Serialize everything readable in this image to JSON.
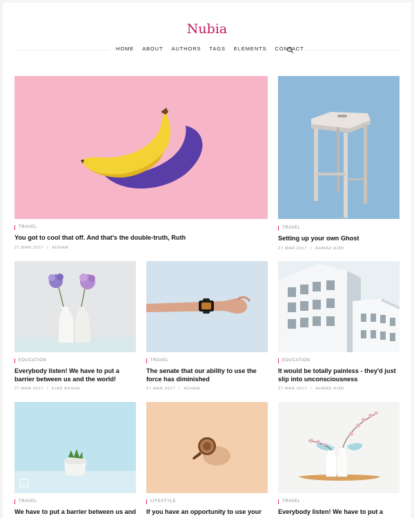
{
  "site": {
    "logo": "Nubia"
  },
  "nav": [
    "Home",
    "About",
    "Authors",
    "Tags",
    "Elements",
    "Contact"
  ],
  "posts": [
    {
      "tag": "Travel",
      "title": "You got to cool that off. And that's the double-truth, Ruth",
      "date": "27.Mar.2017",
      "author": "Adham",
      "image": "banana"
    },
    {
      "tag": "Travel",
      "title": "Setting up your own Ghost",
      "date": "27.Mar.2017",
      "author": "Ahmad Ajmi",
      "image": "stool"
    },
    {
      "tag": "Education",
      "title": "Everybody listen! We have to put a barrier between us and the world!",
      "date": "27.Mar.2017",
      "author": "Eiad Basha",
      "image": "flowers"
    },
    {
      "tag": "Travel",
      "title": "The senate that our ability to use the force has diminished",
      "date": "27.Mar.2017",
      "author": "Adham",
      "image": "watch"
    },
    {
      "tag": "Education",
      "title": "It would be totally painless - they'd just slip into unconsciousness",
      "date": "27.Mar.2017",
      "author": "Ahmad Ajmi",
      "image": "building"
    },
    {
      "tag": "Travel",
      "title": "We have to put a barrier between us and",
      "date": "",
      "author": "",
      "image": "plant"
    },
    {
      "tag": "Lifestyle",
      "title": "If you have an opportunity to use your",
      "date": "",
      "author": "",
      "image": "coffee"
    },
    {
      "tag": "Travel",
      "title": "Everybody listen! We have to put a",
      "date": "",
      "author": "",
      "image": "vase"
    }
  ],
  "colors": {
    "accent": "#e3265f",
    "logo": "#c2185b"
  }
}
